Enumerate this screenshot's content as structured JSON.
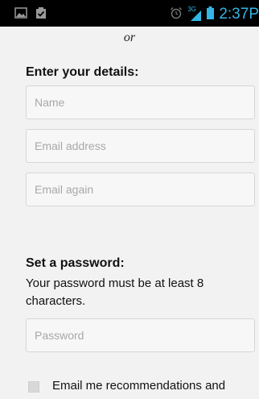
{
  "status_bar": {
    "time": "2:37",
    "time_suffix": "P",
    "icons": [
      "image-icon",
      "clipboard-check-icon",
      "alarm-icon",
      "signal-3g-icon",
      "battery-icon"
    ],
    "network_label": "3G"
  },
  "divider_text": "or",
  "details_section": {
    "title": "Enter your details:",
    "name_placeholder": "Name",
    "email_placeholder": "Email address",
    "email_again_placeholder": "Email again"
  },
  "password_section": {
    "title": "Set a password:",
    "help_text": "Your password must be at least 8 characters.",
    "password_placeholder": "Password"
  },
  "recommendations_checkbox": {
    "label": "Email me recommendations and",
    "checked": false
  },
  "colors": {
    "status_accent": "#33b5e5",
    "background": "#f2f2f2",
    "field_border": "#d6d6d6"
  }
}
